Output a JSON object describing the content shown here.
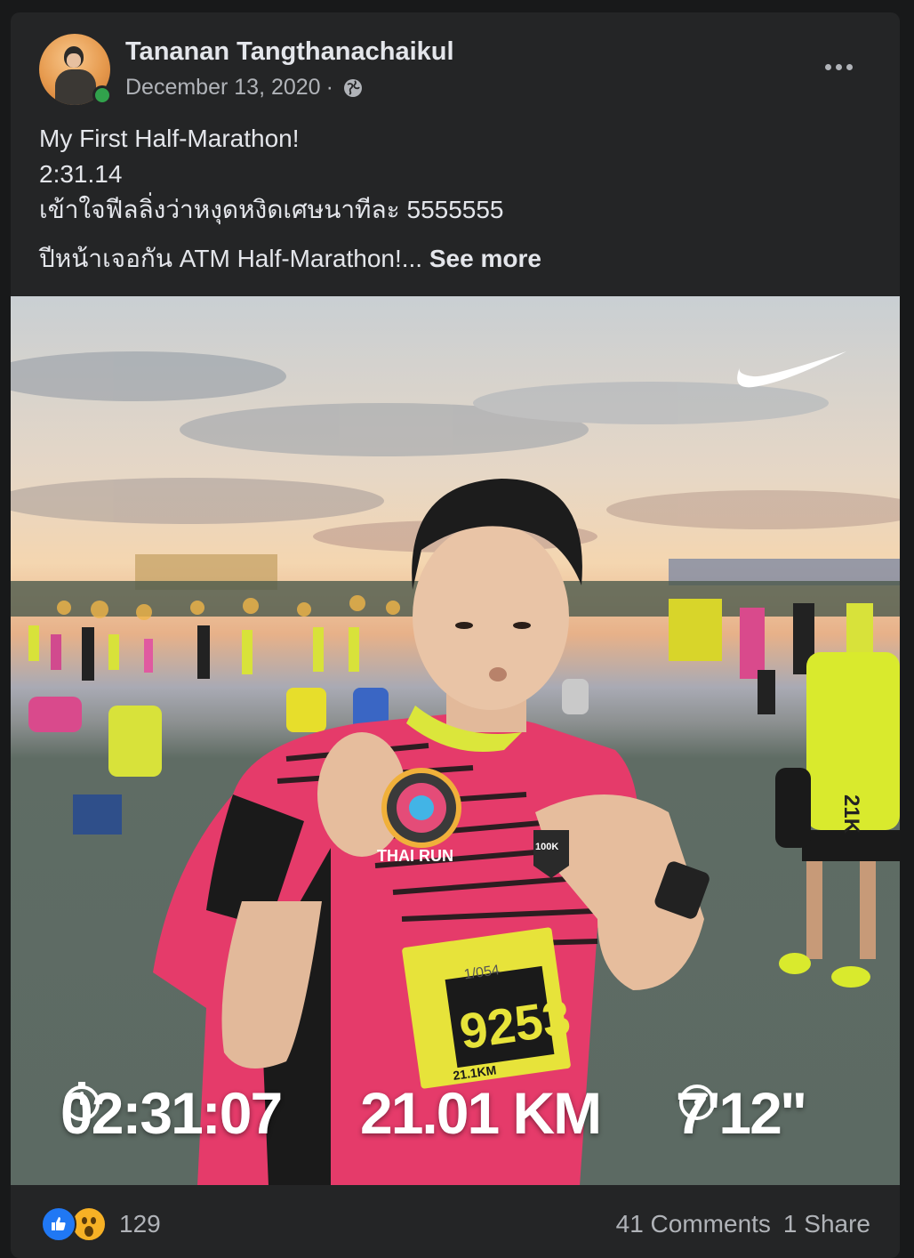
{
  "post": {
    "author": "Tananan Tangthanachaikul",
    "date": "December 13, 2020",
    "separator": "·",
    "privacy_icon": "globe-icon",
    "more_icon": "more-horizontal-icon",
    "text_lines": [
      "My First Half-Marathon!",
      "2:31.14",
      "เข้าใจฟีลลิ่งว่าหงุดหงิดเศษนาทีละ 5555555"
    ],
    "last_line": "ปีหน้าเจอกัน ATM Half-Marathon!...",
    "see_more": "See more"
  },
  "photo": {
    "description_icon": "nike-swoosh-icon",
    "stats": {
      "time": "02:31:07",
      "distance": "21.01 KM",
      "pace": "7'12''"
    },
    "bib_number": "9253",
    "bib_distance": "21.1KM",
    "shirt_text": "THAI RUN",
    "badge_text": "100K",
    "bib_small": "1/054",
    "vest_text": "21K"
  },
  "engagement": {
    "reaction_icons": [
      "like-icon",
      "wow-icon"
    ],
    "reaction_count": "129",
    "comments": "41 Comments",
    "shares": "1 Share"
  },
  "colors": {
    "background": "#18191a",
    "card": "#242526",
    "primary_text": "#e4e6eb",
    "secondary_text": "#b0b3b8",
    "online": "#31a24c",
    "like": "#2078f4",
    "wow": "#f7b125"
  }
}
